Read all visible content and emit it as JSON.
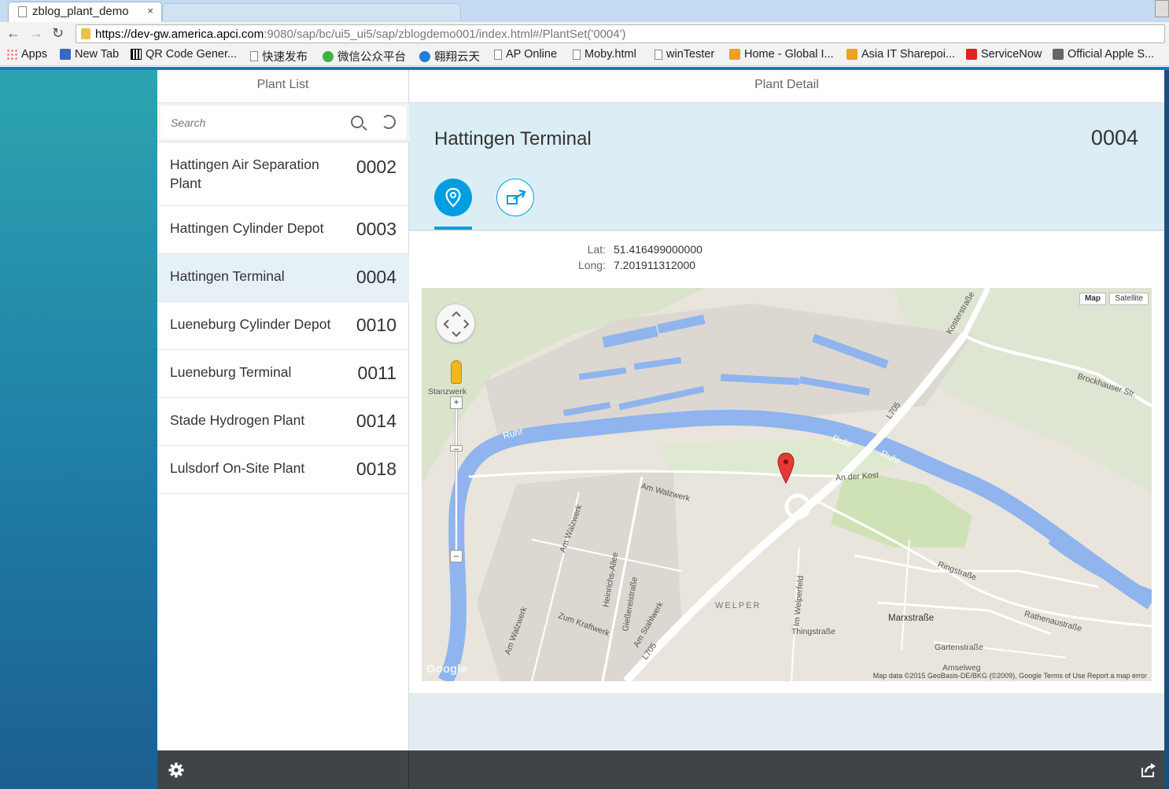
{
  "browser": {
    "tab_title": "zblog_plant_demo",
    "tab_close": "×",
    "url_host": "https://dev-gw.america.apci.com",
    "url_rest": ":9080/sap/bc/ui5_ui5/sap/zblogdemo001/index.html#/PlantSet('0004')",
    "bookmarks": [
      {
        "label": "Apps",
        "icon": "apps-icon"
      },
      {
        "label": "New Tab",
        "icon": "new-tab-icon"
      },
      {
        "label": "QR Code Gener...",
        "icon": "qr-icon"
      },
      {
        "label": "快速发布",
        "icon": "page-icon"
      },
      {
        "label": "微信公众平台",
        "icon": "wechat-icon"
      },
      {
        "label": "翱翔云天",
        "icon": "swirl-icon"
      },
      {
        "label": "AP Online",
        "icon": "page-icon"
      },
      {
        "label": "Moby.html",
        "icon": "page-icon"
      },
      {
        "label": "winTester",
        "icon": "page-icon"
      },
      {
        "label": "Home - Global I...",
        "icon": "sharepoint-icon"
      },
      {
        "label": "Asia IT Sharepoi...",
        "icon": "sharepoint-icon"
      },
      {
        "label": "ServiceNow",
        "icon": "servicenow-icon"
      },
      {
        "label": "Official Apple S...",
        "icon": "apple-icon"
      }
    ]
  },
  "master": {
    "title": "Plant List",
    "search_placeholder": "Search",
    "items": [
      {
        "name": "Hattingen Air Separation Plant",
        "number": "0002",
        "selected": false
      },
      {
        "name": "Hattingen Cylinder Depot",
        "number": "0003",
        "selected": false
      },
      {
        "name": "Hattingen Terminal",
        "number": "0004",
        "selected": true
      },
      {
        "name": "Lueneburg Cylinder Depot",
        "number": "0010",
        "selected": false
      },
      {
        "name": "Lueneburg Terminal",
        "number": "0011",
        "selected": false
      },
      {
        "name": "Stade Hydrogen Plant",
        "number": "0014",
        "selected": false
      },
      {
        "name": "Lulsdorf On-Site Plant",
        "number": "0018",
        "selected": false
      }
    ]
  },
  "detail": {
    "title": "Plant Detail",
    "object_title": "Hattingen Terminal",
    "object_number": "0004",
    "lat_label": "Lat:",
    "lat_value": "51.416499000000",
    "long_label": "Long:",
    "long_value": "7.201911312000"
  },
  "map": {
    "type_map": "Map",
    "type_satellite": "Satellite",
    "labels": {
      "stanzwerk": "Stanzwerk",
      "ruhr1": "Ruhr",
      "ruhr2": "Ruhr",
      "ruhr3": "Ruhr",
      "l705a": "L705",
      "l705b": "L705",
      "kosterstrasse": "Kosterstraße",
      "brockhauser": "Brockhauser Str.",
      "an_der_kost": "An der Kost",
      "am_walzwerk": "Am Walzwerk",
      "am_walzwerk2": "Am Walzwerk",
      "heinrichs_allee": "Heinrichs-Allee",
      "giesserei": "Gießereistraße",
      "zum_kraftwerk": "Zum Kraftwerk",
      "am_stahlwerk": "Am Stahlwerk",
      "am_walzwerk3": "Am Walzwerk",
      "welper": "WELPER",
      "im_welperfeld": "Im Welperfeld",
      "thingstrasse": "Thingstraße",
      "ringstrasse": "Ringstraße",
      "marxstrasse": "Marxstraße",
      "rathenaustrasse": "Rathenaustraße",
      "gartenstrasse": "Gartenstraße",
      "amselweg": "Amselweg",
      "google": "Google"
    },
    "attribution": "Map data ©2015 GeoBasis-DE/BKG (©2009), Google    Terms of Use    Report a map error"
  },
  "colors": {
    "accent": "#009de0",
    "selected_row": "#e5f0f7",
    "footer": "#3f4448",
    "river": "#8fb4ee",
    "marker": "#e53935"
  }
}
